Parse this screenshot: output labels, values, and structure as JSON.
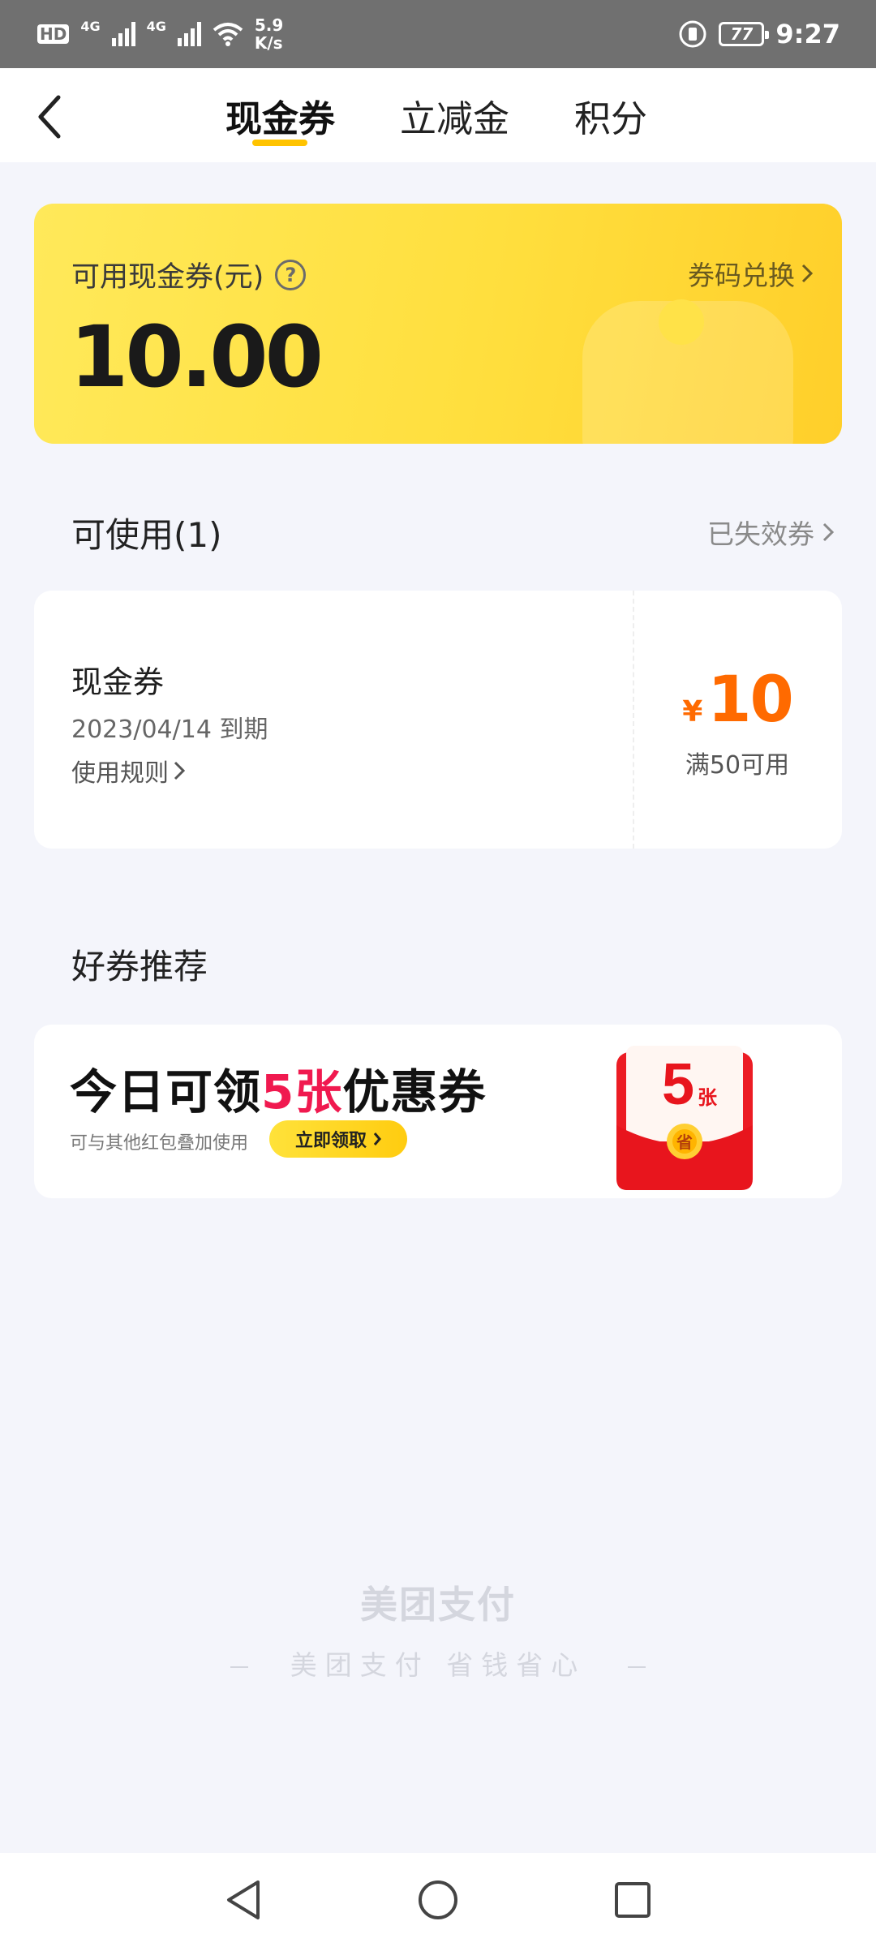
{
  "status_bar": {
    "hd": "HD",
    "net1": "4G",
    "net2": "4G",
    "speed_value": "5.9",
    "speed_unit": "K/s",
    "battery": "77",
    "time": "9:27"
  },
  "header": {
    "tabs": [
      {
        "label": "现金券",
        "active": true
      },
      {
        "label": "立减金",
        "active": false
      },
      {
        "label": "积分",
        "active": false
      }
    ],
    "accent_color": "#ffc300"
  },
  "balance": {
    "label": "可用现金券(元)",
    "amount": "10.00",
    "redeem_label": "券码兑换"
  },
  "available": {
    "title": "可使用(1)",
    "expired_label": "已失效券",
    "coupons": [
      {
        "name": "现金券",
        "expiry": "2023/04/14 到期",
        "rules_label": "使用规则",
        "currency": "¥",
        "amount": "10",
        "condition": "满50可用"
      }
    ]
  },
  "recommend": {
    "title": "好券推荐",
    "headline_pre": "今日可领",
    "headline_highlight": "5张",
    "headline_post": "优惠券",
    "subtext": "可与其他红包叠加使用",
    "button_label": "立即领取",
    "redpack_number": "5",
    "redpack_unit": "张",
    "redpack_seal": "省"
  },
  "footer": {
    "brand": "美团支付",
    "slogan": "美团支付 省钱省心"
  }
}
